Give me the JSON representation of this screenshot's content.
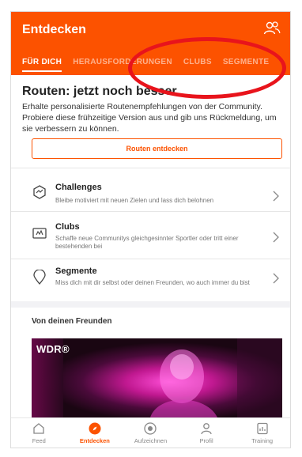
{
  "header": {
    "title": "Entdecken",
    "friends_icon": "friends-icon",
    "color": "#fc5200"
  },
  "tabs": [
    {
      "label": "FÜR DICH",
      "active": true
    },
    {
      "label": "HERAUSFORDERUNGEN",
      "active": false
    },
    {
      "label": "CLUBS",
      "active": false
    },
    {
      "label": "SEGMENTE",
      "active": false
    }
  ],
  "routes": {
    "title": "Routen: jetzt noch besser",
    "description": "Erhalte personalisierte Routenempfehlungen von der Community. Probiere diese frühzeitige Version aus und gib uns Rückmeldung, um sie verbessern zu können.",
    "button_label": "Routen entdecken"
  },
  "items": [
    {
      "title": "Challenges",
      "subtitle": "Bleibe motiviert mit neuen Zielen und lass dich belohnen",
      "icon": "challenge-badge-icon"
    },
    {
      "title": "Clubs",
      "subtitle": "Schaffe neue Communitys gleichgesinnter Sportler oder tritt einer bestehenden bei",
      "icon": "clubs-flag-icon"
    },
    {
      "title": "Segmente",
      "subtitle": "Miss dich mit dir selbst oder deinen Freunden, wo auch immer du bist",
      "icon": "segment-pin-icon"
    }
  ],
  "friends_section": {
    "title": "Von deinen Freunden",
    "photo_logo": "WDR®"
  },
  "bottom_nav": [
    {
      "label": "Feed",
      "icon": "home-icon",
      "active": false
    },
    {
      "label": "Entdecken",
      "icon": "compass-icon",
      "active": true
    },
    {
      "label": "Aufzeichnen",
      "icon": "record-icon",
      "active": false
    },
    {
      "label": "Profil",
      "icon": "profile-icon",
      "active": false
    },
    {
      "label": "Training",
      "icon": "training-icon",
      "active": false
    }
  ],
  "annotation_color": "#e8141c"
}
